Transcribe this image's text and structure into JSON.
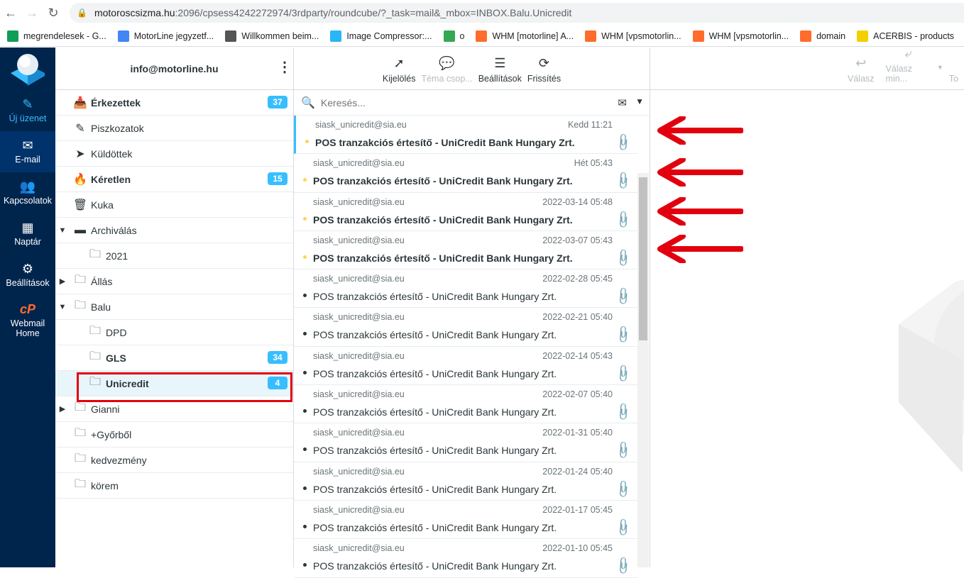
{
  "browser": {
    "url_host": "motoroscsizma.hu",
    "url_path": ":2096/cpsess4242272974/3rdparty/roundcube/?_task=mail&_mbox=INBOX.Balu.Unicredit",
    "bookmarks": [
      {
        "label": "megrendelesek - G...",
        "color": "#0f9d58"
      },
      {
        "label": "MotorLine jegyzetf...",
        "color": "#4285f4"
      },
      {
        "label": "Willkommen beim...",
        "color": "#555555"
      },
      {
        "label": "Image Compressor:...",
        "color": "#29b6f6"
      },
      {
        "label": "o",
        "color": "#34a853"
      },
      {
        "label": "WHM [motorline] A...",
        "color": "#ff6c2c"
      },
      {
        "label": "WHM [vpsmotorlin...",
        "color": "#ff6c2c"
      },
      {
        "label": "WHM [vpsmotorlin...",
        "color": "#ff6c2c"
      },
      {
        "label": "domain",
        "color": "#ff6c2c"
      },
      {
        "label": "ACERBIS - products",
        "color": "#f4d000"
      }
    ]
  },
  "taskmenu": {
    "compose": "Új üzenet",
    "mail": "E-mail",
    "contacts": "Kapcsolatok",
    "calendar": "Naptár",
    "settings": "Beállítások",
    "webmail_home": "Webmail Home"
  },
  "account": "info@motorline.hu",
  "folders": [
    {
      "name": "Érkezettek",
      "count": "37",
      "bold": true,
      "icon": "inbox-icon",
      "glyph": "📥",
      "toggle": "",
      "sub": false
    },
    {
      "name": "Piszkozatok",
      "count": "",
      "bold": false,
      "icon": "pencil-icon",
      "glyph": "✎",
      "toggle": "",
      "sub": false
    },
    {
      "name": "Küldöttek",
      "count": "",
      "bold": false,
      "icon": "send-icon",
      "glyph": "➤",
      "toggle": "",
      "sub": false
    },
    {
      "name": "Kéretlen",
      "count": "15",
      "bold": true,
      "icon": "fire-icon",
      "glyph": "🔥",
      "toggle": "",
      "sub": false
    },
    {
      "name": "Kuka",
      "count": "",
      "bold": false,
      "icon": "trash-icon",
      "glyph": "🗑",
      "toggle": "",
      "sub": false
    },
    {
      "name": "Archiválás",
      "count": "",
      "bold": false,
      "icon": "archive-icon",
      "glyph": "▬",
      "toggle": "▼",
      "sub": false
    },
    {
      "name": "2021",
      "count": "",
      "bold": false,
      "icon": "folder-icon",
      "glyph": "🗀",
      "toggle": "",
      "sub": true
    },
    {
      "name": "Állás",
      "count": "",
      "bold": false,
      "icon": "folder-icon",
      "glyph": "🗀",
      "toggle": "▶",
      "sub": false
    },
    {
      "name": "Balu",
      "count": "",
      "bold": false,
      "icon": "folder-icon",
      "glyph": "🗀",
      "toggle": "▼",
      "sub": false
    },
    {
      "name": "DPD",
      "count": "",
      "bold": false,
      "icon": "folder-icon",
      "glyph": "🗀",
      "toggle": "",
      "sub": true
    },
    {
      "name": "GLS",
      "count": "34",
      "bold": true,
      "icon": "folder-icon",
      "glyph": "🗀",
      "toggle": "",
      "sub": true
    },
    {
      "name": "Unicredit",
      "count": "4",
      "bold": true,
      "icon": "folder-icon",
      "glyph": "🗀",
      "toggle": "",
      "sub": true,
      "selected": true
    },
    {
      "name": "Gianni",
      "count": "",
      "bold": false,
      "icon": "folder-icon",
      "glyph": "🗀",
      "toggle": "▶",
      "sub": false
    },
    {
      "name": "+Győrből",
      "count": "",
      "bold": false,
      "icon": "folder-icon",
      "glyph": "🗀",
      "toggle": "",
      "sub": false
    },
    {
      "name": "kedvezmény",
      "count": "",
      "bold": false,
      "icon": "folder-icon",
      "glyph": "🗀",
      "toggle": "",
      "sub": false
    },
    {
      "name": "körem",
      "count": "",
      "bold": false,
      "icon": "folder-icon",
      "glyph": "🗀",
      "toggle": "",
      "sub": false
    }
  ],
  "list_toolbar": {
    "select": "Kijelölés",
    "threads": "Téma csop...",
    "options": "Beállítások",
    "refresh": "Frissítés"
  },
  "search": {
    "placeholder": "Keresés..."
  },
  "messages": [
    {
      "from": "siask_unicredit@sia.eu",
      "date": "Kedd 11:21",
      "subject": "POS tranzakciós értesítő - UniCredit Bank Hungary Zrt.",
      "unread": true
    },
    {
      "from": "siask_unicredit@sia.eu",
      "date": "Hét 05:43",
      "subject": "POS tranzakciós értesítő - UniCredit Bank Hungary Zrt.",
      "unread": true
    },
    {
      "from": "siask_unicredit@sia.eu",
      "date": "2022-03-14 05:48",
      "subject": "POS tranzakciós értesítő - UniCredit Bank Hungary Zrt.",
      "unread": true
    },
    {
      "from": "siask_unicredit@sia.eu",
      "date": "2022-03-07 05:43",
      "subject": "POS tranzakciós értesítő - UniCredit Bank Hungary Zrt.",
      "unread": true
    },
    {
      "from": "siask_unicredit@sia.eu",
      "date": "2022-02-28 05:45",
      "subject": "POS tranzakciós értesítő - UniCredit Bank Hungary Zrt.",
      "unread": false
    },
    {
      "from": "siask_unicredit@sia.eu",
      "date": "2022-02-21 05:40",
      "subject": "POS tranzakciós értesítő - UniCredit Bank Hungary Zrt.",
      "unread": false
    },
    {
      "from": "siask_unicredit@sia.eu",
      "date": "2022-02-14 05:43",
      "subject": "POS tranzakciós értesítő - UniCredit Bank Hungary Zrt.",
      "unread": false
    },
    {
      "from": "siask_unicredit@sia.eu",
      "date": "2022-02-07 05:40",
      "subject": "POS tranzakciós értesítő - UniCredit Bank Hungary Zrt.",
      "unread": false
    },
    {
      "from": "siask_unicredit@sia.eu",
      "date": "2022-01-31 05:40",
      "subject": "POS tranzakciós értesítő - UniCredit Bank Hungary Zrt.",
      "unread": false
    },
    {
      "from": "siask_unicredit@sia.eu",
      "date": "2022-01-24 05:40",
      "subject": "POS tranzakciós értesítő - UniCredit Bank Hungary Zrt.",
      "unread": false
    },
    {
      "from": "siask_unicredit@sia.eu",
      "date": "2022-01-17 05:45",
      "subject": "POS tranzakciós értesítő - UniCredit Bank Hungary Zrt.",
      "unread": false
    },
    {
      "from": "siask_unicredit@sia.eu",
      "date": "2022-01-10 05:45",
      "subject": "POS tranzakciós értesítő - UniCredit Bank Hungary Zrt.",
      "unread": false
    }
  ],
  "content_toolbar": {
    "reply": "Válasz",
    "reply_all": "Válasz min...",
    "forward": "To"
  },
  "colors": {
    "accent": "#37beff",
    "sidebar": "#00254d",
    "annotation_red": "#e2000f",
    "unread_dot": "#ffd452"
  }
}
